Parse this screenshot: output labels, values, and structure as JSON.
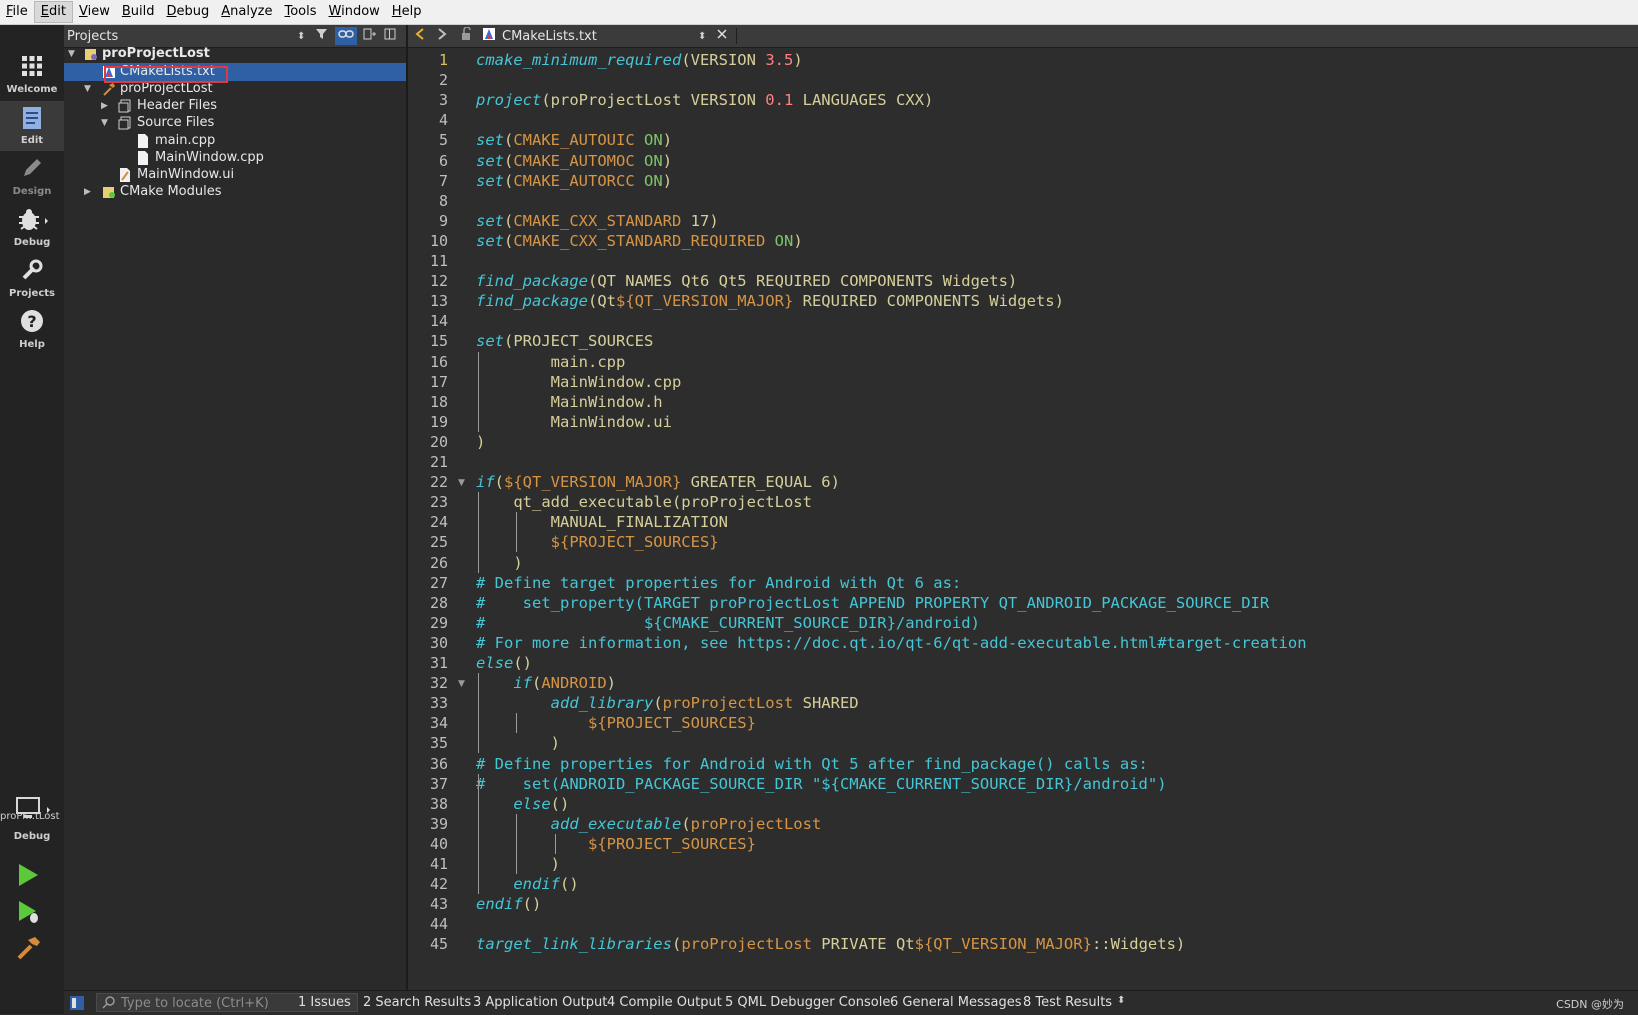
{
  "menu": [
    "File",
    "Edit",
    "View",
    "Build",
    "Debug",
    "Analyze",
    "Tools",
    "Window",
    "Help"
  ],
  "menu_underline": [
    "F",
    "E",
    "V",
    "B",
    "D",
    "A",
    "T",
    "W",
    "H"
  ],
  "modes": [
    {
      "label": "Welcome",
      "icon": "grid-icon"
    },
    {
      "label": "Edit",
      "icon": "edit-document-icon"
    },
    {
      "label": "Design",
      "icon": "pencil-icon"
    },
    {
      "label": "Debug",
      "icon": "bug-icon"
    },
    {
      "label": "Projects",
      "icon": "wrench-icon"
    },
    {
      "label": "Help",
      "icon": "help-icon"
    }
  ],
  "kit": {
    "name": "proPr...tLost",
    "mode": "Debug"
  },
  "projects_pane": {
    "title": "Projects"
  },
  "tree": [
    {
      "label": "proProjectLost",
      "bold": true,
      "icon": "cmake-project-icon"
    },
    {
      "label": "CMakeLists.txt",
      "selected": true,
      "icon": "cmake-file-icon"
    },
    {
      "label": "proProjectLost",
      "icon": "hammer-icon"
    },
    {
      "label": "Header Files",
      "icon": "folder-icon"
    },
    {
      "label": "Source Files",
      "icon": "folder-icon"
    },
    {
      "label": "main.cpp",
      "icon": "file-icon"
    },
    {
      "label": "MainWindow.cpp",
      "icon": "file-icon"
    },
    {
      "label": "MainWindow.ui",
      "icon": "ui-file-icon"
    },
    {
      "label": "CMake Modules",
      "icon": "cmake-modules-icon"
    }
  ],
  "editor": {
    "file_name": "CMakeLists.txt",
    "current_line": 1
  },
  "code": [
    [
      [
        "k",
        "cmake_minimum_required"
      ],
      [
        "t",
        "(VERSION "
      ],
      [
        "n",
        "3.5"
      ],
      [
        "t",
        ")"
      ]
    ],
    [],
    [
      [
        "k",
        "project"
      ],
      [
        "t",
        "(proProjectLost VERSION "
      ],
      [
        "n",
        "0.1"
      ],
      [
        "t",
        " LANGUAGES CXX)"
      ]
    ],
    [],
    [
      [
        "k",
        "set"
      ],
      [
        "t",
        "("
      ],
      [
        "v",
        "CMAKE_AUTOUIC"
      ],
      [
        "t",
        " "
      ],
      [
        "o",
        "ON"
      ],
      [
        "t",
        ")"
      ]
    ],
    [
      [
        "k",
        "set"
      ],
      [
        "t",
        "("
      ],
      [
        "v",
        "CMAKE_AUTOMOC"
      ],
      [
        "t",
        " "
      ],
      [
        "o",
        "ON"
      ],
      [
        "t",
        ")"
      ]
    ],
    [
      [
        "k",
        "set"
      ],
      [
        "t",
        "("
      ],
      [
        "v",
        "CMAKE_AUTORCC"
      ],
      [
        "t",
        " "
      ],
      [
        "o",
        "ON"
      ],
      [
        "t",
        ")"
      ]
    ],
    [],
    [
      [
        "k",
        "set"
      ],
      [
        "t",
        "("
      ],
      [
        "v",
        "CMAKE_CXX_STANDARD"
      ],
      [
        "t",
        " 17)"
      ]
    ],
    [
      [
        "k",
        "set"
      ],
      [
        "t",
        "("
      ],
      [
        "v",
        "CMAKE_CXX_STANDARD_REQUIRED"
      ],
      [
        "t",
        " "
      ],
      [
        "o",
        "ON"
      ],
      [
        "t",
        ")"
      ]
    ],
    [],
    [
      [
        "k",
        "find_package"
      ],
      [
        "t",
        "(QT NAMES Qt6 Qt5 REQUIRED COMPONENTS Widgets)"
      ]
    ],
    [
      [
        "k",
        "find_package"
      ],
      [
        "t",
        "(Qt"
      ],
      [
        "v",
        "${QT_VERSION_MAJOR}"
      ],
      [
        "t",
        " REQUIRED COMPONENTS Widgets)"
      ]
    ],
    [],
    [
      [
        "k",
        "set"
      ],
      [
        "t",
        "(PROJECT_SOURCES"
      ]
    ],
    [
      [
        "t",
        "        main.cpp"
      ]
    ],
    [
      [
        "t",
        "        MainWindow.cpp"
      ]
    ],
    [
      [
        "t",
        "        MainWindow.h"
      ]
    ],
    [
      [
        "t",
        "        MainWindow.ui"
      ]
    ],
    [
      [
        "t",
        ")"
      ]
    ],
    [],
    [
      [
        "k",
        "if"
      ],
      [
        "t",
        "("
      ],
      [
        "v",
        "${QT_VERSION_MAJOR}"
      ],
      [
        "t",
        " GREATER_EQUAL 6)"
      ]
    ],
    [
      [
        "t",
        "    qt_add_executable(proProjectLost"
      ]
    ],
    [
      [
        "t",
        "        MANUAL_FINALIZATION"
      ]
    ],
    [
      [
        "t",
        "        "
      ],
      [
        "v",
        "${PROJECT_SOURCES}"
      ]
    ],
    [
      [
        "t",
        "    )"
      ]
    ],
    [
      [
        "c",
        "# Define target properties for Android with Qt 6 as:"
      ]
    ],
    [
      [
        "c",
        "#    set_property(TARGET proProjectLost APPEND PROPERTY QT_ANDROID_PACKAGE_SOURCE_DIR"
      ]
    ],
    [
      [
        "c",
        "#                 ${CMAKE_CURRENT_SOURCE_DIR}/android)"
      ]
    ],
    [
      [
        "c",
        "# For more information, see https://doc.qt.io/qt-6/qt-add-executable.html#target-creation"
      ]
    ],
    [
      [
        "k",
        "else"
      ],
      [
        "t",
        "()"
      ]
    ],
    [
      [
        "t",
        "    "
      ],
      [
        "k",
        "if"
      ],
      [
        "t",
        "("
      ],
      [
        "v",
        "ANDROID"
      ],
      [
        "t",
        ")"
      ]
    ],
    [
      [
        "t",
        "        "
      ],
      [
        "k",
        "add_library"
      ],
      [
        "t",
        "("
      ],
      [
        "v",
        "proProjectLost"
      ],
      [
        "t",
        " SHARED"
      ]
    ],
    [
      [
        "t",
        "            "
      ],
      [
        "v",
        "${PROJECT_SOURCES}"
      ]
    ],
    [
      [
        "t",
        "        )"
      ]
    ],
    [
      [
        "c",
        "# Define properties for Android with Qt 5 after find_package() calls as:"
      ]
    ],
    [
      [
        "c",
        "#    set(ANDROID_PACKAGE_SOURCE_DIR \"${CMAKE_CURRENT_SOURCE_DIR}/android\")"
      ]
    ],
    [
      [
        "t",
        "    "
      ],
      [
        "k",
        "else"
      ],
      [
        "t",
        "()"
      ]
    ],
    [
      [
        "t",
        "        "
      ],
      [
        "k",
        "add_executable"
      ],
      [
        "t",
        "("
      ],
      [
        "v",
        "proProjectLost"
      ]
    ],
    [
      [
        "t",
        "            "
      ],
      [
        "v",
        "${PROJECT_SOURCES}"
      ]
    ],
    [
      [
        "t",
        "        )"
      ]
    ],
    [
      [
        "t",
        "    "
      ],
      [
        "k",
        "endif"
      ],
      [
        "t",
        "()"
      ]
    ],
    [
      [
        "k",
        "endif"
      ],
      [
        "t",
        "()"
      ]
    ],
    [],
    [
      [
        "k",
        "target_link_libraries"
      ],
      [
        "t",
        "("
      ],
      [
        "v",
        "proProjectLost"
      ],
      [
        "t",
        " PRIVATE Qt"
      ],
      [
        "v",
        "${QT_VERSION_MAJOR}"
      ],
      [
        "t",
        "::Widgets)"
      ]
    ]
  ],
  "status": {
    "locator_placeholder": "Type to locate (Ctrl+K)",
    "tabs": [
      "1  Issues",
      "2  Search Results",
      "3  Application Output",
      "4  Compile Output",
      "5  QML Debugger Console",
      "6  General Messages",
      "8  Test Results"
    ],
    "watermark": "CSDN @妙为"
  },
  "colors": {
    "keyword": "#45c6d6",
    "variable": "#d69545",
    "number": "#ff8080",
    "on": "#7ec46a",
    "selection": "#2f5fa5",
    "highlight_box": "#e23a3a"
  }
}
